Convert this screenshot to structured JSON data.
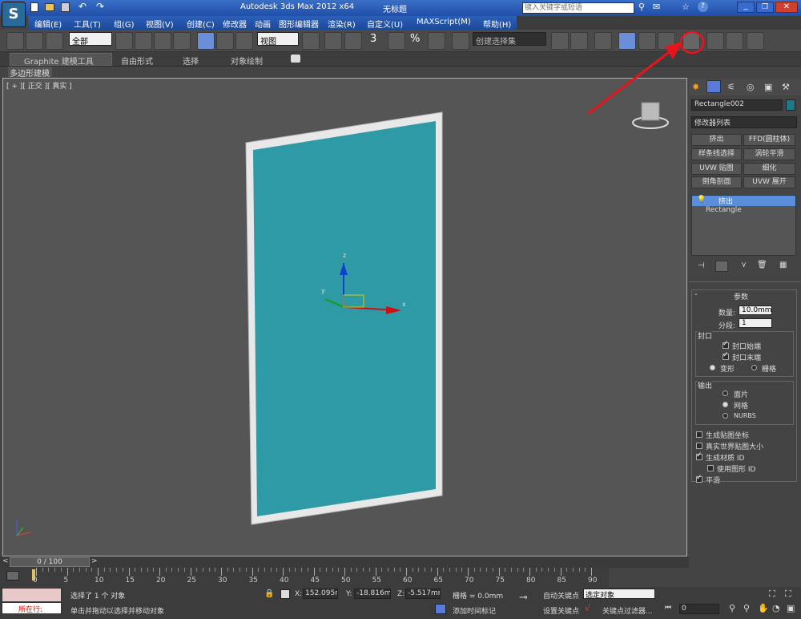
{
  "titlebar": {
    "app_title": "Autodesk 3ds Max  2012 x64",
    "doc_title": "无标题",
    "search_placeholder": "键入关键字或短语"
  },
  "menu": [
    "编辑(E)",
    "工具(T)",
    "组(G)",
    "视图(V)",
    "创建(C)",
    "修改器",
    "动画",
    "图形编辑器",
    "渲染(R)",
    "自定义(U)",
    "MAXScript(M)",
    "帮助(H)"
  ],
  "toolbar": {
    "filter_select": "全部",
    "view_select": "视图",
    "selection_set": "创建选择集",
    "snap_label": "3",
    "percent_label": "%"
  },
  "ribbon": {
    "tabs": [
      "Graphite 建模工具",
      "自由形式",
      "选择",
      "对象绘制"
    ],
    "subtab": "多边形建模"
  },
  "viewport": {
    "label": "[ + ][ 正交 ][ 真实 ]",
    "axis_x": "x",
    "axis_y": "y",
    "axis_z": "z",
    "object_color": "#2e9aa6",
    "frame_color": "#e8e8e8"
  },
  "cmdpanel": {
    "object_name": "Rectangle002",
    "modifier_list": "修改器列表",
    "modifier_buttons": [
      "挤出",
      "FFD(圆柱体)",
      "样条线选择",
      "涡轮平滑",
      "UVW 贴图",
      "细化",
      "倒角剖面",
      "UVW 展开"
    ],
    "stack": [
      "挤出",
      "Rectangle"
    ],
    "rollout_title": "参数",
    "amount_label": "数量:",
    "amount_value": "10.0mm",
    "segments_label": "分段:",
    "segments_value": "1",
    "capping_title": "封口",
    "cap_start": "封口始端",
    "cap_end": "封口末端",
    "morph": "变形",
    "grid": "栅格",
    "output_title": "输出",
    "out_patch": "面片",
    "out_mesh": "网格",
    "out_nurbs": "NURBS",
    "gen_map": "生成贴图坐标",
    "real_world": "真实世界贴图大小",
    "gen_mat": "生成材质 ID",
    "use_shape": "使用图形 ID",
    "smooth": "平滑"
  },
  "timeline": {
    "frame": "0 / 100",
    "ticks": [
      "0",
      "5",
      "10",
      "15",
      "20",
      "25",
      "30",
      "35",
      "40",
      "45",
      "50",
      "55",
      "60",
      "65",
      "70",
      "75",
      "80",
      "85",
      "90"
    ]
  },
  "status": {
    "running": "所在行:",
    "selected": "选择了 1 个 对象",
    "hint": "单击并拖动以选择并移动对象",
    "x_label": "X:",
    "x_value": "152.095mm",
    "y_label": "Y:",
    "y_value": "-18.816mm",
    "z_label": "Z:",
    "z_value": "-5.517mm",
    "grid": "栅格 = 0.0mm",
    "add_time_tag": "添加时间标记",
    "auto_key": "自动关键点",
    "set_key": "设置关键点",
    "selected_obj": "选定对象",
    "key_filter": "关键点过滤器...",
    "frame_field": "0"
  },
  "annotation_color": "#e8141c"
}
